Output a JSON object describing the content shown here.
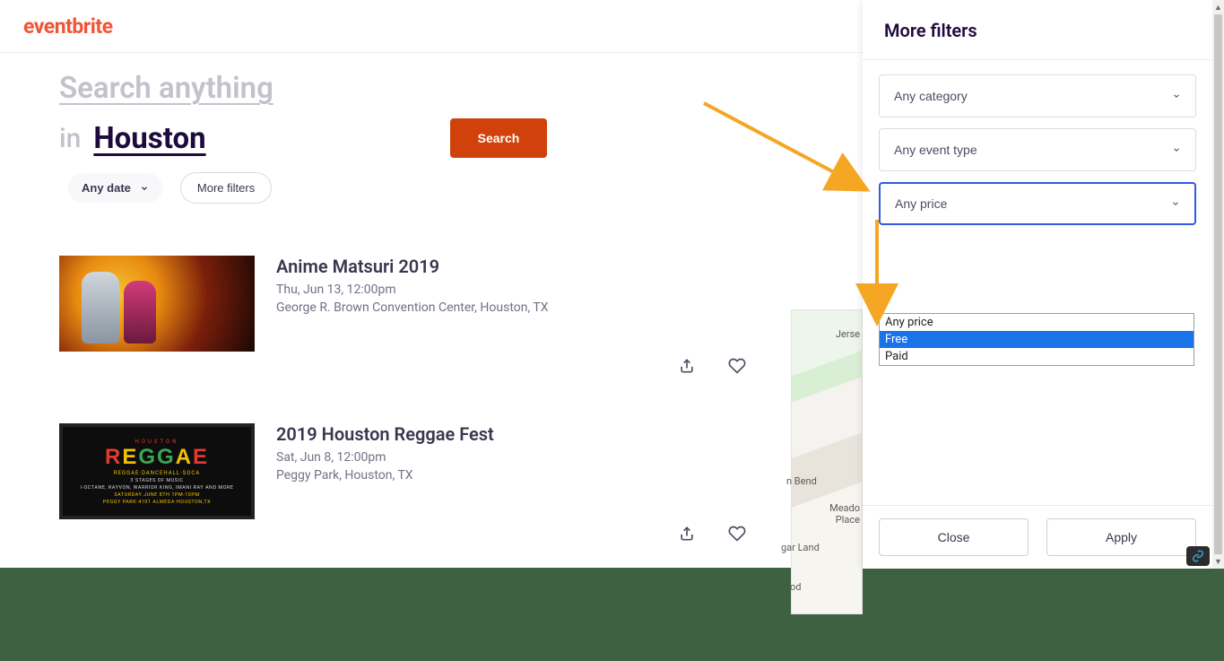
{
  "brand": "eventbrite",
  "search": {
    "placeholder": "Search anything",
    "in_word": "in",
    "location": "Houston",
    "button": "Search"
  },
  "pills": {
    "any_date": "Any date",
    "more_filters": "More filters"
  },
  "events": [
    {
      "title": "Anime Matsuri 2019",
      "date": "Thu, Jun 13, 12:00pm",
      "venue": "George R. Brown Convention Center, Houston, TX"
    },
    {
      "title": "2019 Houston Reggae Fest",
      "date": "Sat, Jun 8, 12:00pm",
      "venue": "Peggy Park, Houston, TX"
    }
  ],
  "thumb2": {
    "top": "HOUSTON",
    "sub": "REGGAE·DANCEHALL·SOCA",
    "stages": "3 STAGES OF MUSIC",
    "lineup": "I-OCTANE, RAYVON, WARRIOR KING, IMANI RAY AND MORE",
    "when": "SATURDAY JUNE 8TH 1PM-10PM",
    "where": "PEGGY PARK·4101 ALMEDA·HOUSTON,TX"
  },
  "map": {
    "labels": [
      "Jerse",
      "n Bend",
      "Meado",
      "Place",
      "gar Land",
      "od"
    ]
  },
  "panel": {
    "title": "More filters",
    "selects": {
      "category": "Any category",
      "event_type": "Any event type",
      "price": "Any price"
    },
    "price_options": [
      "Any price",
      "Free",
      "Paid"
    ],
    "close": "Close",
    "apply": "Apply"
  }
}
